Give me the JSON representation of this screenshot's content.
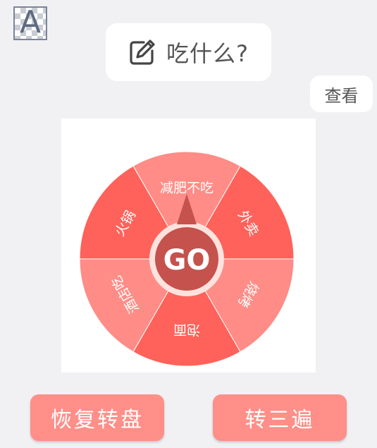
{
  "avatar": {
    "letter": "A"
  },
  "header": {
    "title": "吃什么?",
    "title_icon": "edit-icon"
  },
  "view_button": {
    "label": "查看"
  },
  "wheel": {
    "center_label": "GO",
    "segments": [
      {
        "label": "减肥不吃",
        "color": "#ff8c86"
      },
      {
        "label": "外卖",
        "color": "#ff625a"
      },
      {
        "label": "烧烤",
        "color": "#ff8c86"
      },
      {
        "label": "泡面",
        "color": "#ff625a"
      },
      {
        "label": "酒店吃",
        "color": "#ff8c86"
      },
      {
        "label": "火锅",
        "color": "#ff625a"
      }
    ],
    "hub_color": "#c5524d",
    "hub_ring_color": "#ffe2de"
  },
  "buttons": {
    "reset_label": "恢复转盘",
    "three_label": "转三遍"
  }
}
